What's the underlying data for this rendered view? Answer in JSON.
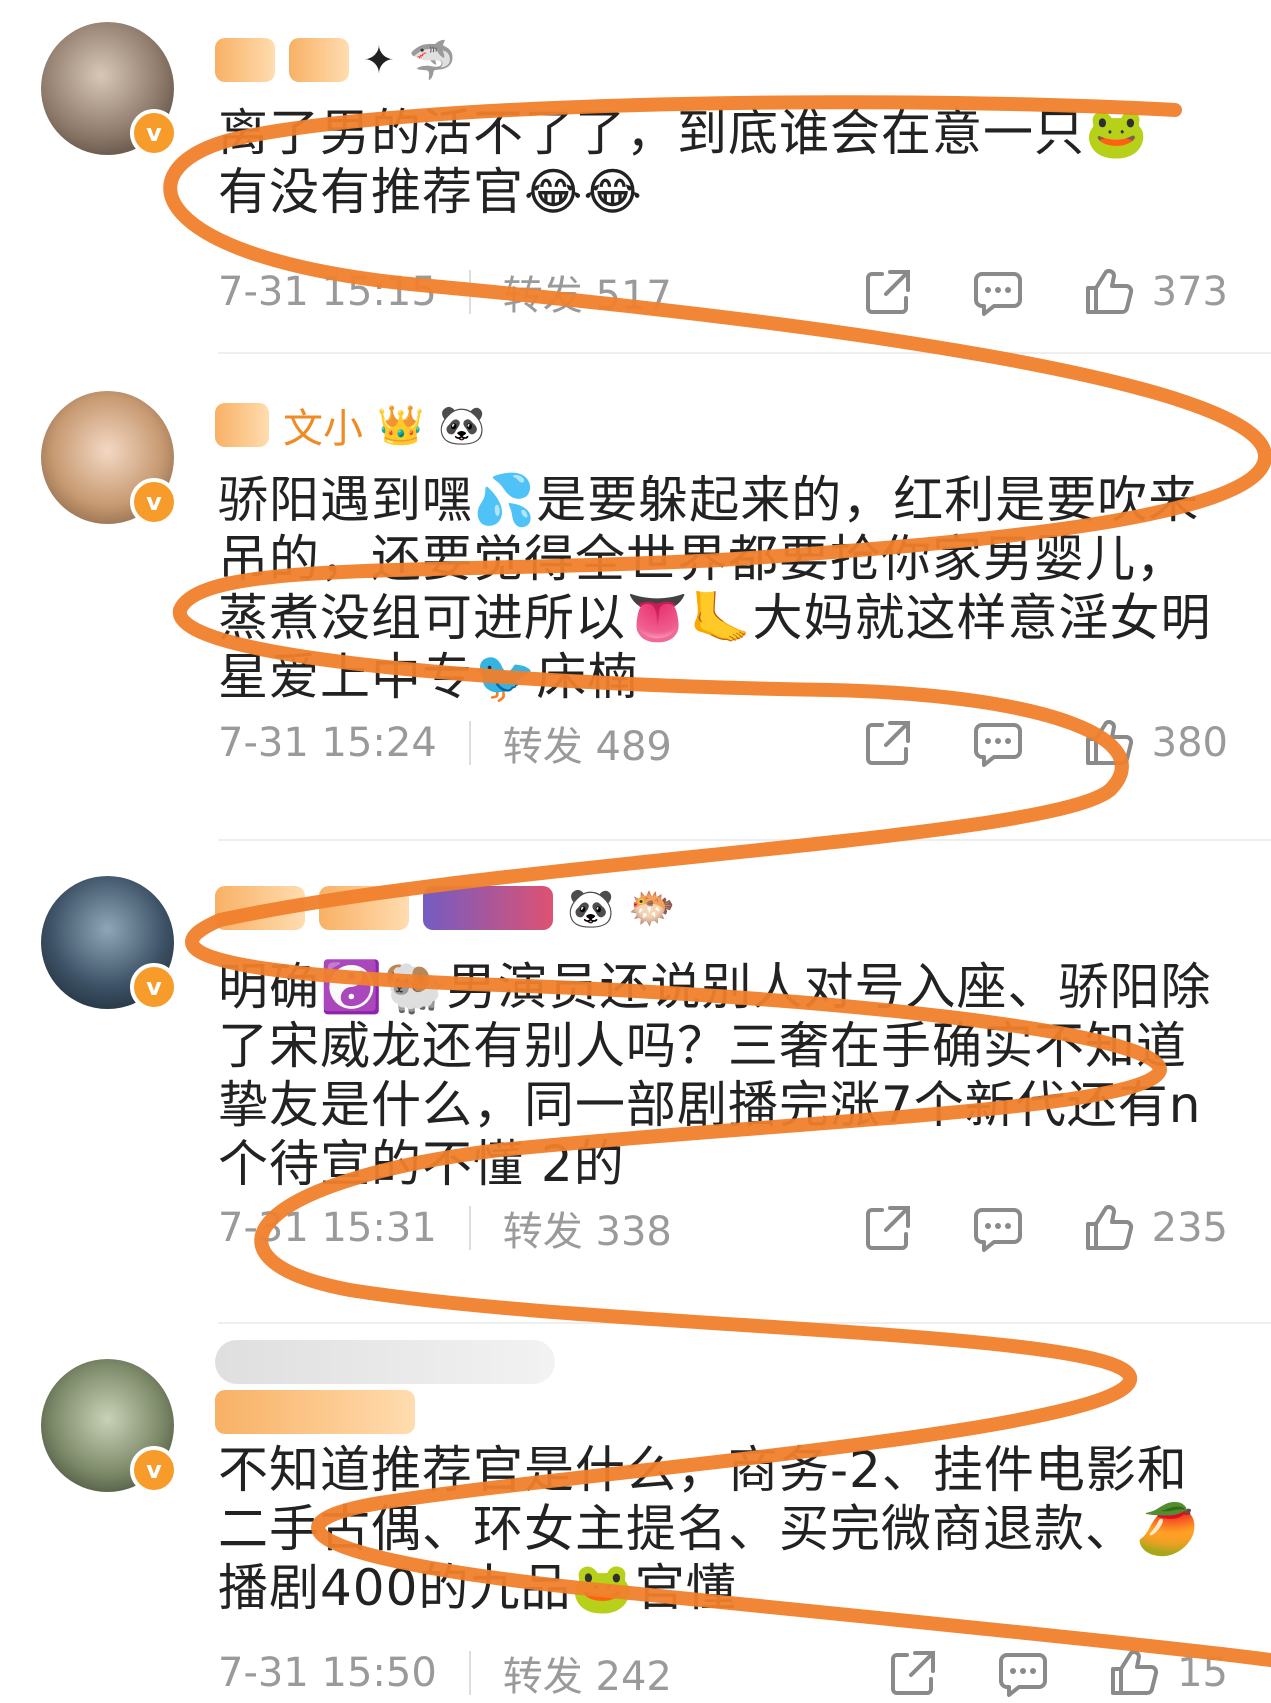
{
  "comments": [
    {
      "name_decor": [
        "✦",
        "✦",
        "🦈"
      ],
      "text": "离了男的活不了了，到底谁会在意一只🐸\n有没有推荐官😂😂",
      "time": "7-31 15:15",
      "repost": "转发 517",
      "likes": "373"
    },
    {
      "name_text": "文小",
      "name_decor": [
        "👑",
        "🐼"
      ],
      "text": "骄阳遇到嘿💦是要躲起来的，红利是要吹来吊的，还要觉得全世界都要抢你家男婴儿，蒸煮没组可进所以👅🦶大妈就这样意淫女明星爱上中专🐦床楠",
      "time": "7-31 15:24",
      "repost": "转发 489",
      "likes": "380"
    },
    {
      "name_decor": [
        "🐼",
        "🐡"
      ],
      "text": "明确☯️🐏男演员还说别人对号入座、骄阳除了宋威龙还有别人吗？三奢在手确实不知道挚友是什么，同一部剧播完涨7个新代还有n个待宣的不懂 2的",
      "time": "7-31 15:31",
      "repost": "转发 338",
      "likes": "235"
    },
    {
      "text": "不知道推荐官是什么，商务-2、挂件电影和二手古偶、环女主提名、买完微商退款、🥭播剧400的九品🐸官懂",
      "time": "7-31 15:50",
      "repost": "转发 242",
      "likes": "15"
    }
  ],
  "icons": {
    "share": "share-icon",
    "comment": "comment-icon",
    "like": "thumbs-up-icon",
    "verified": "verified-v-badge"
  },
  "colors": {
    "scribble": "#f07f2c",
    "badge": "#f79b2a",
    "meta": "#9a9a9a"
  },
  "badge_letter": "v"
}
